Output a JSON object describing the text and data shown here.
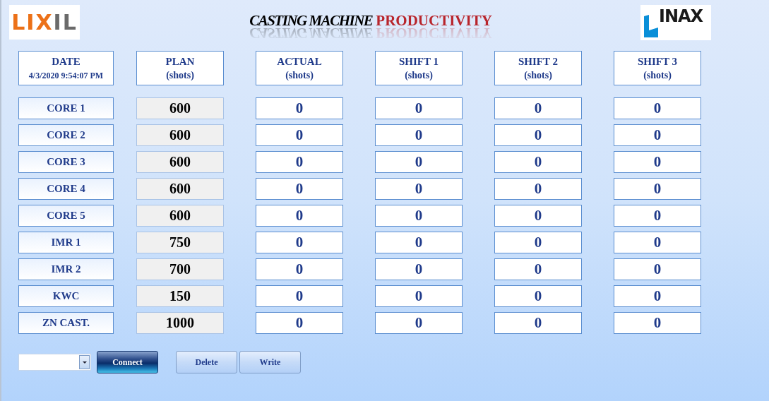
{
  "logos": {
    "left": "LIXIL",
    "right": "INAX"
  },
  "title": {
    "main": "CASTING MACHINE",
    "accent": "PRODUCTIVITY"
  },
  "columns": [
    {
      "title": "DATE",
      "subtitle": "4/3/2020 9:54:07 PM",
      "kind": "date"
    },
    {
      "title": "PLAN",
      "subtitle": "(shots)",
      "kind": "plain"
    },
    {
      "title": "ACTUAL",
      "subtitle": "(shots)",
      "kind": "plain"
    },
    {
      "title": "SHIFT 1",
      "subtitle": "(shots)",
      "kind": "plain"
    },
    {
      "title": "SHIFT 2",
      "subtitle": "(shots)",
      "kind": "plain"
    },
    {
      "title": "SHIFT 3",
      "subtitle": "(shots)",
      "kind": "plain"
    }
  ],
  "rows": [
    {
      "name": "CORE 1",
      "plan": "600",
      "actual": "0",
      "shift1": "0",
      "shift2": "0",
      "shift3": "0"
    },
    {
      "name": "CORE 2",
      "plan": "600",
      "actual": "0",
      "shift1": "0",
      "shift2": "0",
      "shift3": "0"
    },
    {
      "name": "CORE 3",
      "plan": "600",
      "actual": "0",
      "shift1": "0",
      "shift2": "0",
      "shift3": "0"
    },
    {
      "name": "CORE 4",
      "plan": "600",
      "actual": "0",
      "shift1": "0",
      "shift2": "0",
      "shift3": "0"
    },
    {
      "name": "CORE 5",
      "plan": "600",
      "actual": "0",
      "shift1": "0",
      "shift2": "0",
      "shift3": "0"
    },
    {
      "name": "IMR 1",
      "plan": "750",
      "actual": "0",
      "shift1": "0",
      "shift2": "0",
      "shift3": "0"
    },
    {
      "name": "IMR 2",
      "plan": "700",
      "actual": "0",
      "shift1": "0",
      "shift2": "0",
      "shift3": "0"
    },
    {
      "name": "KWC",
      "plan": "150",
      "actual": "0",
      "shift1": "0",
      "shift2": "0",
      "shift3": "0"
    },
    {
      "name": "ZN CAST.",
      "plan": "1000",
      "actual": "0",
      "shift1": "0",
      "shift2": "0",
      "shift3": "0"
    }
  ],
  "buttons": [
    {
      "label": "Connect",
      "kind": "primary"
    },
    {
      "label": "Delete",
      "kind": "normal"
    },
    {
      "label": "Write",
      "kind": "normal"
    }
  ]
}
